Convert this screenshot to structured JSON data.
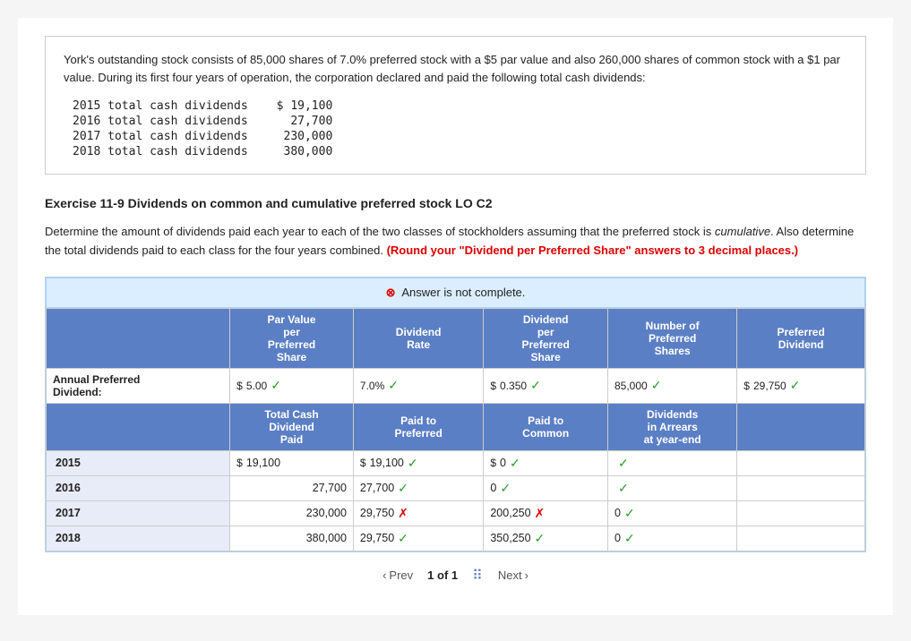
{
  "intro": {
    "text": "York's outstanding stock consists of 85,000 shares of 7.0% preferred stock with a $5 par value and also 260,000 shares of common stock with a $1 par value. During its first four years of operation, the corporation declared and paid the following total cash dividends:",
    "dividends": [
      {
        "year": "2015",
        "label": "total cash dividends",
        "amount": "$ 19,100"
      },
      {
        "year": "2016",
        "label": "total cash dividends",
        "amount": "  27,700"
      },
      {
        "year": "2017",
        "label": "total cash dividends",
        "amount": " 230,000"
      },
      {
        "year": "2018",
        "label": "total cash dividends",
        "amount": " 380,000"
      }
    ]
  },
  "exercise": {
    "title": "Exercise 11-9 Dividends on common and cumulative preferred stock LO C2",
    "instruction_plain": "Determine the amount of dividends paid each year to each of the two classes of stockholders assuming that the preferred stock is ",
    "instruction_italic": "cumulative",
    "instruction_plain2": ". Also determine the total dividends paid to each class for the four years combined. ",
    "instruction_highlight": "(Round your \"Dividend per Preferred Share\" answers to 3 decimal places.)"
  },
  "banner": {
    "text": "Answer is not complete."
  },
  "table": {
    "headers_row1": [
      {
        "label": "Par Value\nper\nPreferred\nShare"
      },
      {
        "label": "Dividend\nRate"
      },
      {
        "label": "Dividend\nper\nPreferred\nShare"
      },
      {
        "label": "Number of\nPreferred\nShares"
      },
      {
        "label": "Preferred\nDividend"
      }
    ],
    "annual_row": {
      "label": "Annual Preferred\nDividend:",
      "par_value_dollar": "$",
      "par_value": "5.00",
      "par_check": "✓",
      "dividend_rate": "7.0%",
      "rate_check": "✓",
      "div_per_share_dollar": "$",
      "div_per_share": "0.350",
      "div_per_share_check": "✓",
      "num_shares": "85,000",
      "num_shares_check": "✓",
      "preferred_div_dollar": "$",
      "preferred_div": "29,750",
      "preferred_div_check": "✓"
    },
    "headers_row2": [
      {
        "label": "Total Cash\nDividend\nPaid"
      },
      {
        "label": "Paid to\nPreferred"
      },
      {
        "label": "Paid to\nCommon"
      },
      {
        "label": "Dividends\nin Arrears\nat year-end"
      }
    ],
    "data_rows": [
      {
        "year": "2015",
        "total_cash": "19,100",
        "total_cash_dollar": "$",
        "paid_preferred": "19,100",
        "paid_preferred_dollar": "$",
        "paid_preferred_check": "✓",
        "paid_common": "0",
        "paid_common_dollar": "$",
        "paid_common_check": "✓",
        "arrears": "",
        "arrears_check": "✓"
      },
      {
        "year": "2016",
        "total_cash": "27,700",
        "paid_preferred": "27,700",
        "paid_preferred_check": "✓",
        "paid_common": "0",
        "paid_common_check": "✓",
        "arrears": "",
        "arrears_check": "✓"
      },
      {
        "year": "2017",
        "total_cash": "230,000",
        "paid_preferred": "29,750",
        "paid_preferred_check": "✗",
        "paid_common": "200,250",
        "paid_common_check": "✗",
        "arrears": "0",
        "arrears_check": "✓"
      },
      {
        "year": "2018",
        "total_cash": "380,000",
        "paid_preferred": "29,750",
        "paid_preferred_check": "✓",
        "paid_common": "350,250",
        "paid_common_check": "✓",
        "arrears": "0",
        "arrears_check": "✓"
      }
    ]
  },
  "pagination": {
    "prev_label": "Prev",
    "page_info": "1 of 1",
    "next_label": "Next"
  }
}
